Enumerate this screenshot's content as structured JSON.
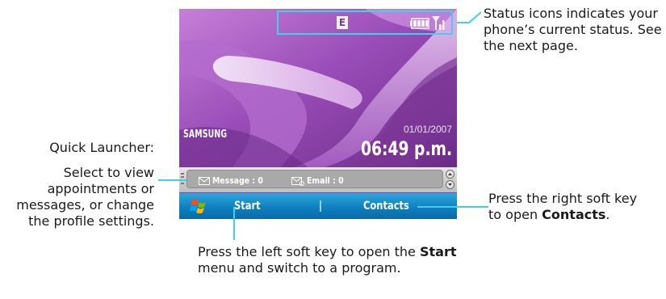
{
  "phone_screen": {
    "brand": "SAMSUNG",
    "date": "01/01/2007",
    "time": "06:49 p.m.",
    "status_icons": [
      "edge-icon",
      "battery-icon",
      "signal-icon"
    ],
    "status_edge_letter": "E",
    "quick_launcher": {
      "message_label": "Message : 0",
      "email_label": "Email : 0"
    },
    "softkeys": {
      "left": "Start",
      "right": "Contacts"
    }
  },
  "annotations": {
    "status_icons": "Status icons indicates your phone’s current status. See the next page.",
    "quick_launcher_title": "Quick Launcher:",
    "quick_launcher_body": "Select to view appointments or messages, or change the profile settings.",
    "right_softkey_before": "Press the right soft key to open ",
    "right_softkey_bold": "Contacts",
    "right_softkey_after": ".",
    "left_softkey_before": "Press the left soft key to open the ",
    "left_softkey_bold": "Start",
    "left_softkey_after": " menu and switch to a program."
  },
  "colors": {
    "wallpaper_purple": "#8a3fa6",
    "softkey_blue": "#1591cf",
    "callout_cyan": "#3fd0ea"
  }
}
